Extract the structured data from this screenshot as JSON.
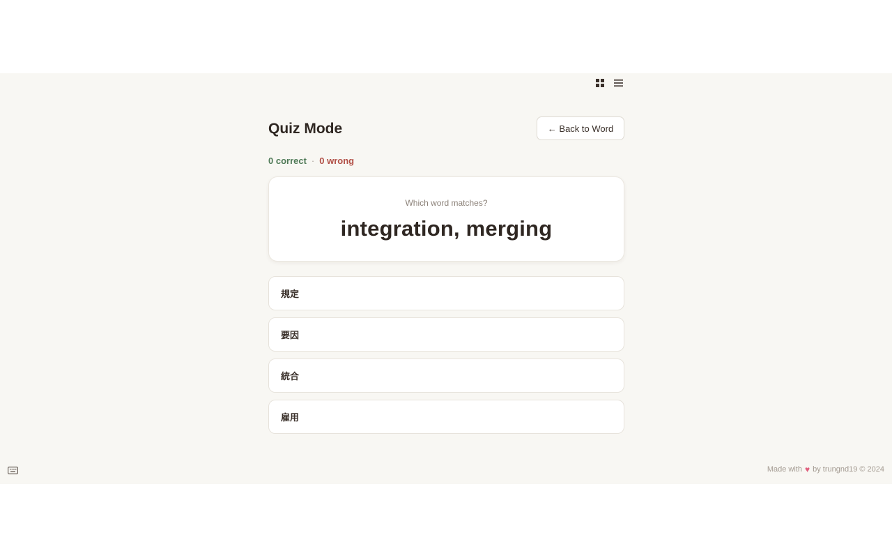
{
  "view_toggle": {
    "grid_icon": "grid-icon",
    "list_icon": "list-icon"
  },
  "header": {
    "title": "Quiz Mode",
    "back_label": "← Back to Word"
  },
  "score": {
    "correct": "0 correct",
    "separator": "·",
    "wrong": "0 wrong"
  },
  "question": {
    "prompt": "Which word matches?",
    "word": "integration, merging"
  },
  "options": [
    {
      "label": "規定"
    },
    {
      "label": "要因"
    },
    {
      "label": "統合"
    },
    {
      "label": "雇用"
    }
  ],
  "footer": {
    "made_with": "Made with",
    "heart": "♥",
    "by": "by trungnd19 © 2024"
  },
  "icons": {
    "keyboard": "keyboard-icon"
  },
  "colors": {
    "background": "#f8f7f3",
    "correct": "#4f7a57",
    "wrong": "#b14f46",
    "heart": "#e0607e"
  }
}
